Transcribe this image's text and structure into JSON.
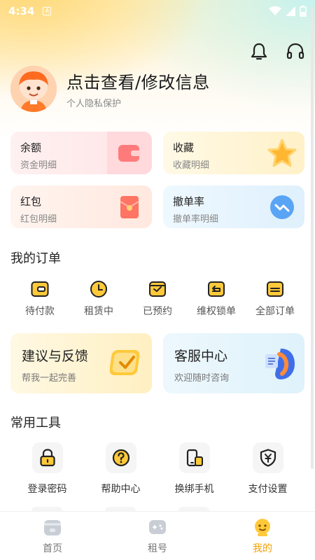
{
  "status_bar": {
    "time": "4:34",
    "notif_letter": "A"
  },
  "profile": {
    "name": "点击查看/修改信息",
    "subtitle": "个人隐私保护"
  },
  "cards": [
    {
      "title": "余额",
      "subtitle": "资金明细",
      "icon": "wallet-icon",
      "bg": "#ffe9ea"
    },
    {
      "title": "收藏",
      "subtitle": "收藏明细",
      "icon": "star-icon",
      "bg": "#fff5d6"
    },
    {
      "title": "红包",
      "subtitle": "红包明细",
      "icon": "red-envelope-icon",
      "bg": "#ffece6"
    },
    {
      "title": "撤单率",
      "subtitle": "撤单率明细",
      "icon": "chart-icon",
      "bg": "#e3f3ff"
    }
  ],
  "orders": {
    "title": "我的订单",
    "items": [
      {
        "label": "待付款",
        "icon": "wallet-icon"
      },
      {
        "label": "租赁中",
        "icon": "clock-icon"
      },
      {
        "label": "已预约",
        "icon": "calendar-icon"
      },
      {
        "label": "维权锁单",
        "icon": "return-icon"
      },
      {
        "label": "全部订单",
        "icon": "orders-icon"
      }
    ]
  },
  "feedback": {
    "title": "建议与反馈",
    "subtitle": "帮我一起完善"
  },
  "service": {
    "title": "客服中心",
    "subtitle": "欢迎随时咨询"
  },
  "tools": {
    "title": "常用工具",
    "items": [
      {
        "label": "登录密码",
        "icon": "lock-icon"
      },
      {
        "label": "帮助中心",
        "icon": "question-icon"
      },
      {
        "label": "换绑手机",
        "icon": "phone-swap-icon"
      },
      {
        "label": "支付设置",
        "icon": "yuan-shield-icon"
      }
    ]
  },
  "tabbar": {
    "items": [
      {
        "label": "首页",
        "icon": "home-icon",
        "active": false
      },
      {
        "label": "租号",
        "icon": "gamepad-icon",
        "active": false
      },
      {
        "label": "我的",
        "icon": "profile-icon",
        "active": true
      }
    ]
  },
  "colors": {
    "accent": "#f5a000",
    "accent_yellow": "#ffc93a"
  }
}
